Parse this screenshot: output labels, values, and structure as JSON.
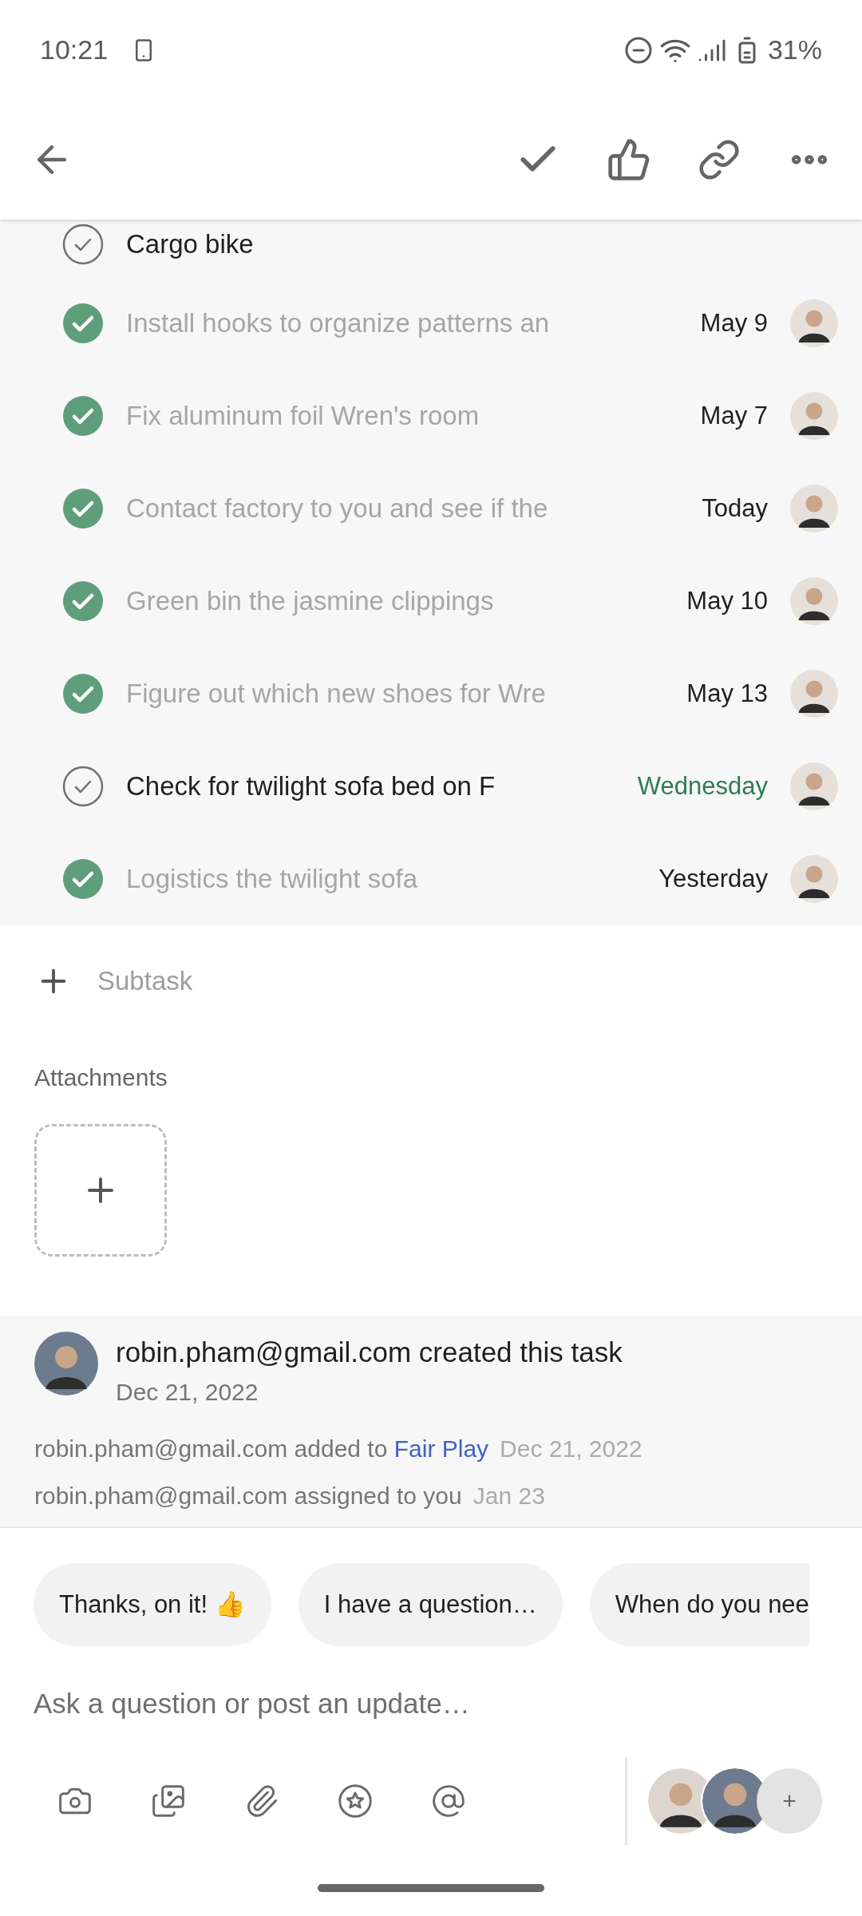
{
  "status_bar": {
    "time": "10:21",
    "battery": "31%"
  },
  "subtasks": [
    {
      "title": "Cargo bike",
      "done": false
    },
    {
      "title": "Install hooks to organize patterns an",
      "done": true,
      "due": "May 9",
      "color": "#1f1f1f"
    },
    {
      "title": "Fix aluminum foil Wren's room",
      "done": true,
      "due": "May 7",
      "color": "#1f1f1f"
    },
    {
      "title": "Contact factory to you and see if the",
      "done": true,
      "due": "Today",
      "color": "#1f1f1f"
    },
    {
      "title": "Green bin the jasmine clippings",
      "done": true,
      "due": "May 10",
      "color": "#1f1f1f"
    },
    {
      "title": "Figure out which new shoes for Wre",
      "done": true,
      "due": "May 13",
      "color": "#1f1f1f"
    },
    {
      "title": "Check for twilight sofa bed on F",
      "done": false,
      "due": "Wednesday",
      "color": "#2f7d52"
    },
    {
      "title": "Logistics the twilight sofa",
      "done": true,
      "due": "Yesterday",
      "color": "#1f1f1f"
    }
  ],
  "add_subtask": {
    "placeholder": "Subtask"
  },
  "attachments": {
    "label": "Attachments"
  },
  "activity": {
    "title": "robin.pham@gmail.com created this task",
    "date": "Dec 21, 2022",
    "events": [
      {
        "actor": "robin.pham@gmail.com",
        "action": "added to",
        "link": "Fair Play",
        "date": "Dec 21, 2022"
      },
      {
        "actor": "robin.pham@gmail.com",
        "action": "assigned to you",
        "date": "Jan 23"
      }
    ]
  },
  "quick_replies": [
    "Thanks, on it! 👍",
    "I have a question…",
    "When do you nee"
  ],
  "composer": {
    "placeholder": "Ask a question or post an update…",
    "add_collaborator": "+"
  }
}
